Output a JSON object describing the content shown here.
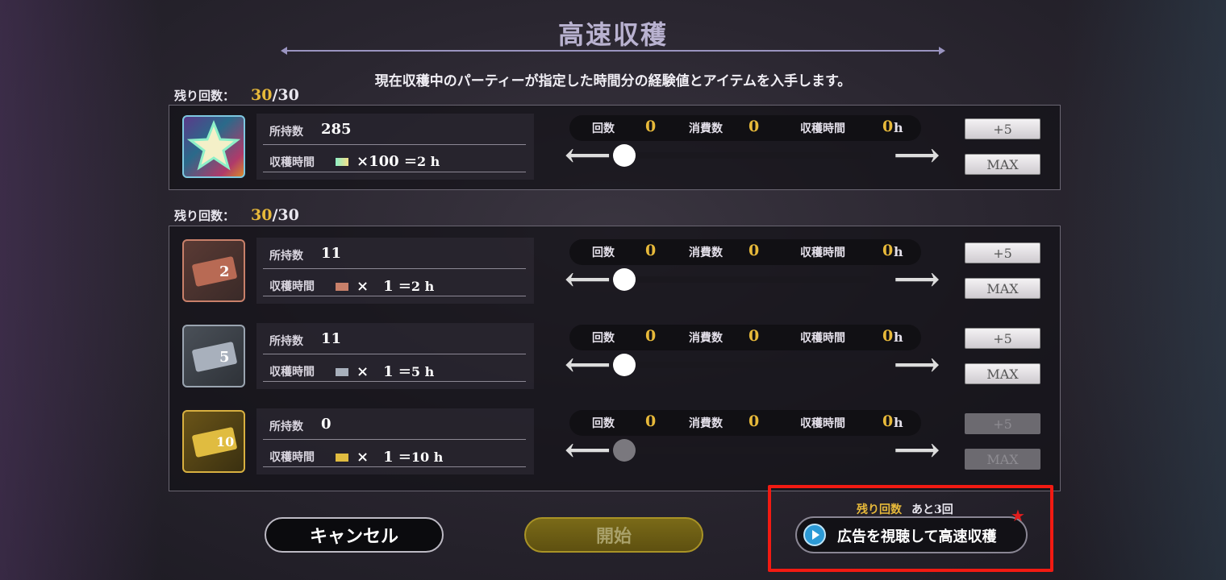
{
  "title": "高速収穫",
  "description": "現在収穫中のパーティーが指定した時間分の経験値とアイテムを入手します。",
  "sections": [
    {
      "remain_label": "残り回数：",
      "remain_current": "30",
      "remain_max": "/30",
      "items": [
        {
          "owned_label": "所持数",
          "owned": "285",
          "time_label": "収穫時間",
          "mult": "×100",
          "eq": "＝2 h",
          "count_label": "回数",
          "count": "0",
          "consume_label": "消費数",
          "consume": "0",
          "harvest_label": "収穫時間",
          "harvest": "0",
          "unit": "h",
          "plus5": "+5",
          "max": "MAX",
          "disabled": false
        }
      ]
    },
    {
      "remain_label": "残り回数：",
      "remain_current": "30",
      "remain_max": "/30",
      "items": [
        {
          "owned_label": "所持数",
          "owned": "11",
          "time_label": "収穫時間",
          "mult": "×　1",
          "eq": "＝2 h",
          "count_label": "回数",
          "count": "0",
          "consume_label": "消費数",
          "consume": "0",
          "harvest_label": "収穫時間",
          "harvest": "0",
          "unit": "h",
          "plus5": "+5",
          "max": "MAX",
          "disabled": false
        },
        {
          "owned_label": "所持数",
          "owned": "11",
          "time_label": "収穫時間",
          "mult": "×　1",
          "eq": "＝5 h",
          "count_label": "回数",
          "count": "0",
          "consume_label": "消費数",
          "consume": "0",
          "harvest_label": "収穫時間",
          "harvest": "0",
          "unit": "h",
          "plus5": "+5",
          "max": "MAX",
          "disabled": false
        },
        {
          "owned_label": "所持数",
          "owned": "0",
          "time_label": "収穫時間",
          "mult": "×　1",
          "eq": "＝10 h",
          "count_label": "回数",
          "count": "0",
          "consume_label": "消費数",
          "consume": "0",
          "harvest_label": "収穫時間",
          "harvest": "0",
          "unit": "h",
          "plus5": "+5",
          "max": "MAX",
          "disabled": true
        }
      ]
    }
  ],
  "ticket_labels": [
    "2",
    "5",
    "10"
  ],
  "buttons": {
    "cancel": "キャンセル",
    "start": "開始"
  },
  "ad": {
    "remain_label": "残り回数",
    "remain_value": "あと3回",
    "button_label": "広告を視聴して高速収穫"
  },
  "colors": {
    "accent_gold": "#e7b93a",
    "highlight_red": "#f21a12",
    "play_blue": "#2c9ad6"
  }
}
